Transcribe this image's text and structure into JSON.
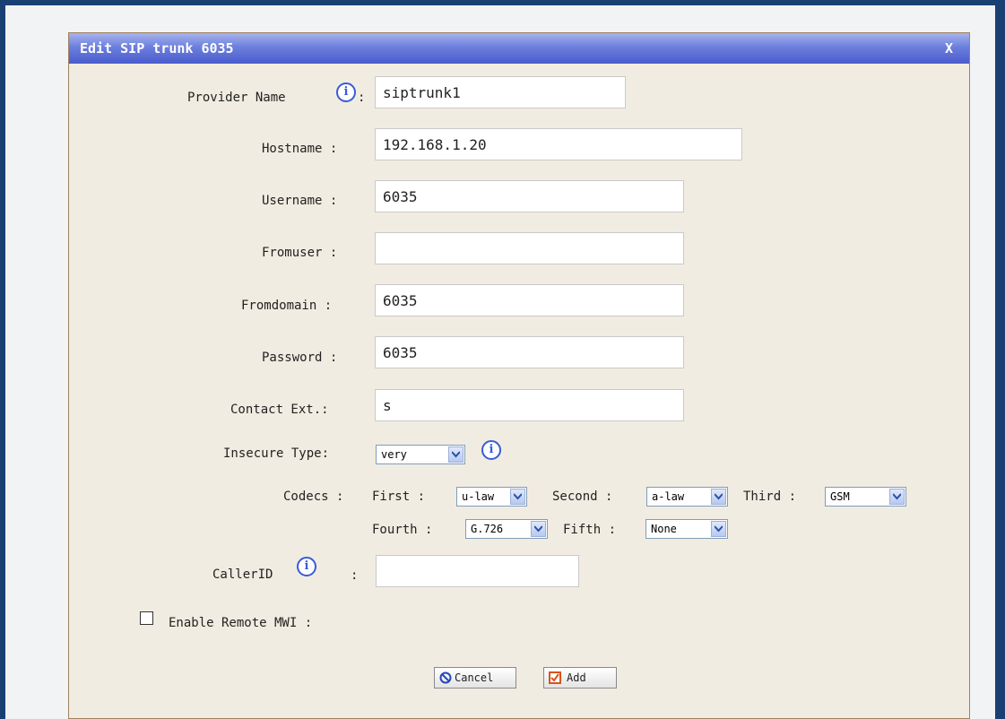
{
  "dialog": {
    "title": "Edit SIP trunk 6035",
    "close_label": "X"
  },
  "fields": {
    "provider_name": {
      "label": "Provider Name",
      "colon": ":",
      "value": "siptrunk1"
    },
    "hostname": {
      "label": "Hostname :",
      "value": "192.168.1.20"
    },
    "username": {
      "label": "Username :",
      "value": "6035"
    },
    "fromuser": {
      "label": "Fromuser :",
      "value": ""
    },
    "fromdomain": {
      "label": "Fromdomain :",
      "value": "6035"
    },
    "password": {
      "label": "Password :",
      "value": "6035"
    },
    "contact_ext": {
      "label": "Contact Ext.:",
      "value": "s"
    },
    "insecure_type": {
      "label": "Insecure Type:",
      "value": "very"
    },
    "codecs": {
      "label": "Codecs :",
      "first_label": "First :",
      "first": "u-law",
      "second_label": "Second :",
      "second": "a-law",
      "third_label": "Third :",
      "third": "GSM",
      "fourth_label": "Fourth :",
      "fourth": "G.726",
      "fifth_label": "Fifth :",
      "fifth": "None"
    },
    "caller_id": {
      "label": "CallerID",
      "colon": ":",
      "value": ""
    },
    "remote_mwi": {
      "label": "Enable Remote MWI :",
      "checked": false
    }
  },
  "buttons": {
    "cancel": "Cancel",
    "add": "Add"
  },
  "icons": {
    "info": "i"
  },
  "colors": {
    "title_bar": "#6d7fdd",
    "dialog_bg": "#f1ece1",
    "info_icon": "#3a5bd6",
    "add_icon": "#d9531e"
  }
}
